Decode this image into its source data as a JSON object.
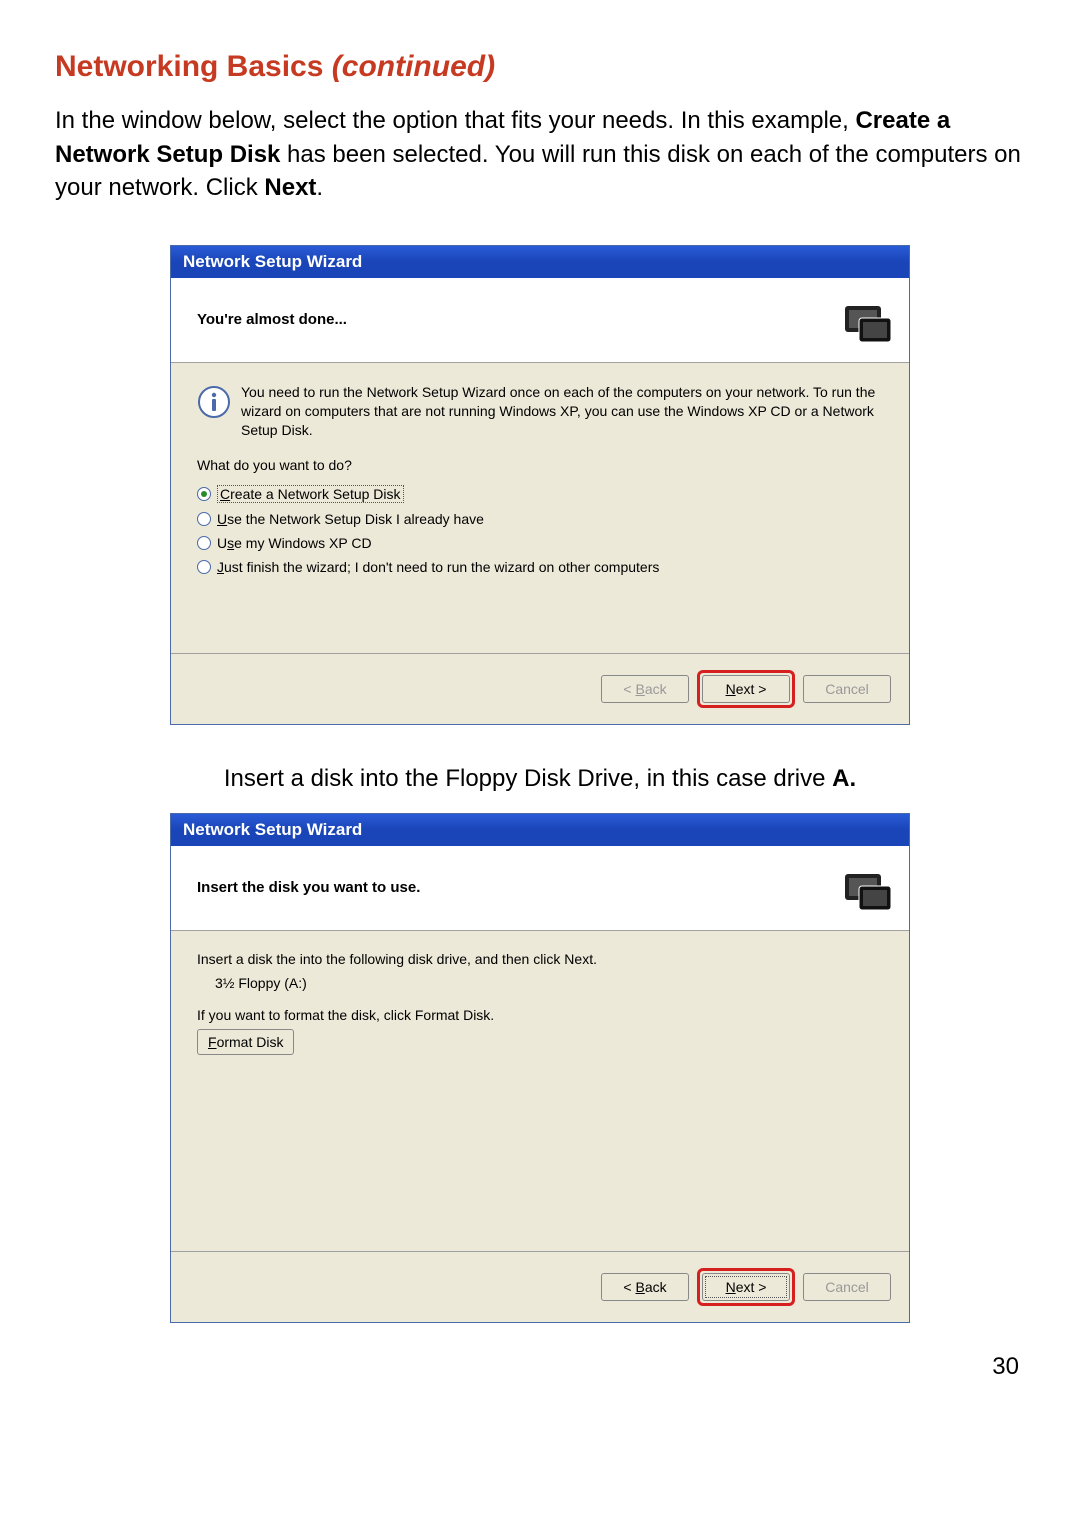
{
  "title_main": "Networking Basics ",
  "title_cont": "(continued)",
  "intro_parts": {
    "p1": "In the window below, select the option that fits your needs.  In this example, ",
    "b1": "Create a Network Setup Disk",
    "p2": " has been selected. You will run this disk on each of the computers on your network.  Click ",
    "b2": "Next",
    "p3": "."
  },
  "wizard1": {
    "titlebar": "Network Setup Wizard",
    "header_title": "You're almost done...",
    "info_text": "You need to run the Network Setup Wizard once on each of the computers on your network. To run the wizard on computers that are not running Windows XP, you can use the Windows XP CD or a Network Setup Disk.",
    "prompt": "What do you want to do?",
    "options": [
      {
        "label": "Create a Network Setup Disk",
        "selected": true,
        "access": "C"
      },
      {
        "label": "Use the Network Setup Disk I already have",
        "selected": false,
        "access": "U"
      },
      {
        "label": "Use my Windows XP CD",
        "selected": false,
        "access": "s"
      },
      {
        "label": "Just finish the wizard; I don't need to run the wizard on other computers",
        "selected": false,
        "access": "J"
      }
    ],
    "buttons": {
      "back": "< Back",
      "next": "Next >",
      "cancel": "Cancel"
    },
    "back_disabled": true,
    "cancel_disabled": true
  },
  "mid_text_parts": {
    "p1": "Insert a disk into the Floppy Disk Drive, in this case drive ",
    "b1": "A.",
    "p2": ""
  },
  "wizard2": {
    "titlebar": "Network Setup Wizard",
    "header_title": "Insert the disk you want to use.",
    "line1": "Insert a disk the into the following disk drive, and then click Next.",
    "drive": "3½ Floppy (A:)",
    "line2": "If you want to format the disk, click Format Disk.",
    "format_btn": "Format Disk",
    "buttons": {
      "back": "< Back",
      "next": "Next >",
      "cancel": "Cancel"
    },
    "cancel_disabled": true
  },
  "page_number": "30"
}
